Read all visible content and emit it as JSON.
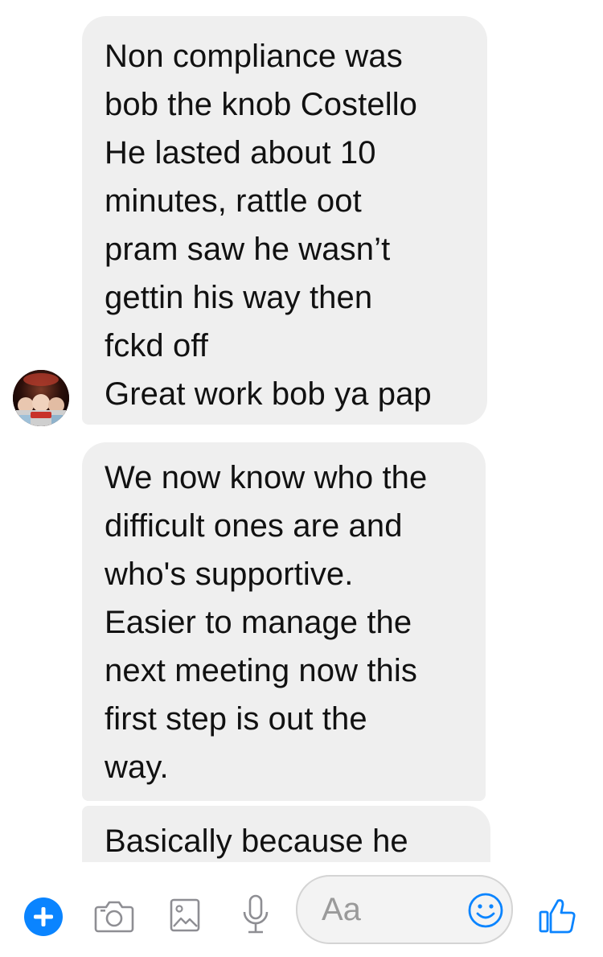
{
  "messages": [
    {
      "id": "m1",
      "text": "Non compliance was\nbob the knob Costello\nHe lasted about 10\nminutes, rattle oot\npram saw he wasn’t\ngettin his way then\nfckd off\nGreat work bob ya pap"
    },
    {
      "id": "m2",
      "text": "We now know who the\ndifficult ones are and\nwho's supportive.\nEasier to manage the\nnext meeting now this\nfirst step is out the\nway."
    },
    {
      "id": "m3",
      "text": "Basically because he"
    }
  ],
  "composer": {
    "placeholder": "Aa",
    "icons": [
      "plus-icon",
      "camera-icon",
      "image-icon",
      "microphone-icon",
      "emoji-icon",
      "thumbs-up-icon"
    ]
  },
  "colors": {
    "bubble": "#efefef",
    "accent": "#0a84ff",
    "icon_gray": "#8e8e93"
  }
}
